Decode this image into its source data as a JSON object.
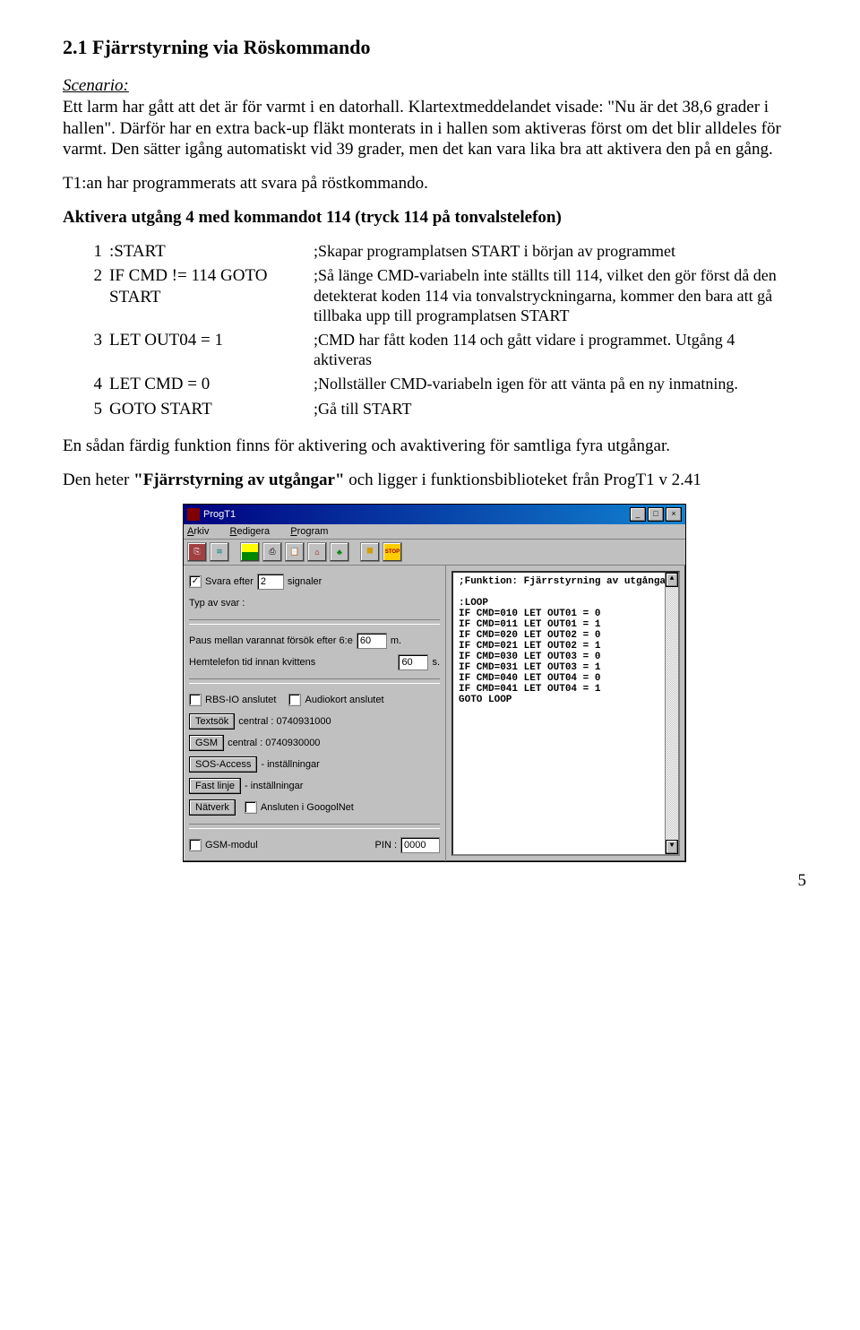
{
  "heading": "2.1 Fjärrstyrning via Röskommando",
  "scenario_label": "Scenario:",
  "para1": "Ett larm har gått att det är för varmt i en datorhall. Klartextmeddelandet visade: \"Nu är det 38,6 grader i hallen\". Därför har en extra back-up fläkt monterats in i hallen som aktiveras först om det blir alldeles för varmt. Den sätter igång automatiskt vid 39 grader, men det kan vara lika bra att aktivera den på en gång.",
  "para2": "T1:an har programmerats att svara på röstkommando.",
  "activate_heading": "Aktivera utgång 4 med kommandot 114 (tryck 114 på tonvalstelefon)",
  "codetable": [
    {
      "n": "1",
      "code": ":START",
      "comment": ";Skapar programplatsen START i början av programmet"
    },
    {
      "n": "2",
      "code": "IF CMD != 114 GOTO START",
      "comment": ";Så länge CMD-variabeln inte ställts till 114, vilket den gör först då den detekterat koden 114 via tonvalstryckningarna, kommer den bara att gå tillbaka upp till programplatsen START"
    },
    {
      "n": "3",
      "code": "LET OUT04 = 1",
      "comment": ";CMD har fått koden 114 och gått vidare i programmet. Utgång 4 aktiveras"
    },
    {
      "n": "4",
      "code": "LET CMD = 0",
      "comment": ";Nollställer CMD-variabeln igen för att vänta på en ny inmatning."
    },
    {
      "n": "5",
      "code": "GOTO START",
      "comment": ";Gå till START"
    }
  ],
  "para3": "En sådan färdig funktion finns för aktivering och avaktivering för samtliga fyra utgångar.",
  "para4a": "Den heter ",
  "para4b": "\"Fjärrstyrning av utgångar\"",
  "para4c": " och ligger i funktionsbiblioteket från ProgT1 v 2.41",
  "win": {
    "title": "ProgT1",
    "menus": {
      "arkiv": "Arkiv",
      "redigera": "Redigera",
      "program": "Program"
    },
    "toolbar_icons": [
      "⎘",
      "≋",
      "",
      "⎙",
      "📋",
      "⌂",
      "♣",
      "⯀",
      "STOP"
    ],
    "left": {
      "svara_chk": "✓",
      "svara_lbl": "Svara efter",
      "svara_val": "2",
      "svara_unit": "signaler",
      "typ_lbl": "Typ av svar :",
      "paus_lbl_a": "Paus mellan varannat försök efter 6:e",
      "paus_val": "60",
      "paus_unit": "m.",
      "hemtel_lbl": "Hemtelefon tid innan kvittens",
      "hemtel_val": "60",
      "hemtel_unit": "s.",
      "rbs_lbl": "RBS-IO anslutet",
      "audio_lbl": "Audiokort anslutet",
      "textsok_btn": "Textsök",
      "textsok_lbl": "central : 0740931000",
      "gsm_btn": "GSM",
      "gsm_lbl": "central : 0740930000",
      "sos_btn": "SOS-Access",
      "sos_lbl": "- inställningar",
      "fast_btn": "Fast linje",
      "fast_lbl": "- inställningar",
      "nat_btn": "Nätverk",
      "nat_lbl": "Ansluten i GoogolNet",
      "gsmmod_lbl": "GSM-modul",
      "pin_lbl": "PIN :",
      "pin_val": "0000"
    },
    "right_lines": [
      ";Funktion: Fjärrstyrning av utgångar",
      "",
      ":LOOP",
      "IF CMD=010 LET OUT01 = 0",
      "IF CMD=011 LET OUT01 = 1",
      "IF CMD=020 LET OUT02 = 0",
      "IF CMD=021 LET OUT02 = 1",
      "IF CMD=030 LET OUT03 = 0",
      "IF CMD=031 LET OUT03 = 1",
      "IF CMD=040 LET OUT04 = 0",
      "IF CMD=041 LET OUT04 = 1",
      "GOTO LOOP"
    ]
  },
  "pagenum": "5"
}
